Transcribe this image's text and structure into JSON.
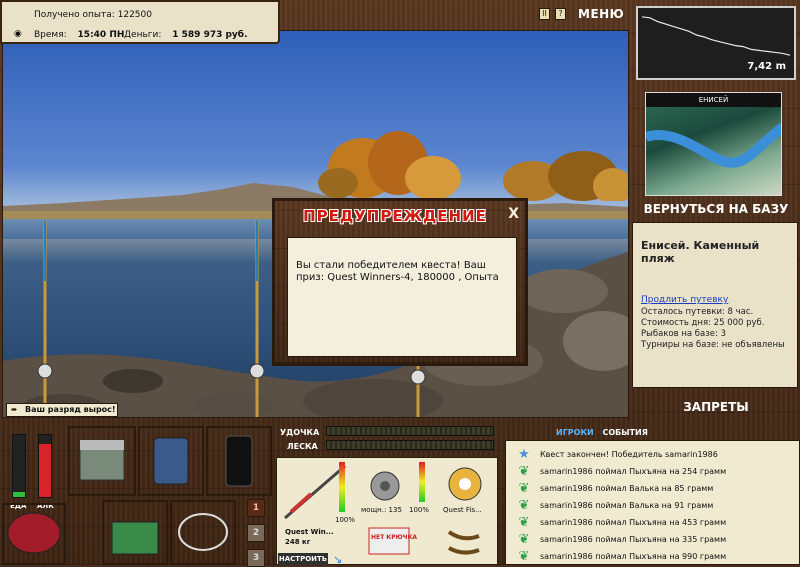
{
  "stats": {
    "exp_label": "Получено опыта:",
    "exp_value": "122500",
    "time_label": "Время:",
    "time_value": "15:40 ПН",
    "money_label": "Деньги:",
    "money_value": "1 589 973 руб."
  },
  "topbar": {
    "pause": "II",
    "help": "?",
    "menu": "МЕНЮ"
  },
  "depth": {
    "value": "7,42 m",
    "profile": [
      0.1,
      0.12,
      0.2,
      0.25,
      0.3,
      0.35,
      0.4,
      0.48,
      0.52,
      0.58,
      0.62,
      0.66,
      0.7,
      0.72,
      0.78,
      0.8,
      0.82,
      0.84,
      0.86,
      0.9
    ]
  },
  "map": {
    "title": "ЕНИСЕЙ"
  },
  "right_panel": {
    "return_label": "ВЕРНУТЬСЯ НА БАЗУ",
    "location_title": "Енисей. Каменный пляж",
    "extend_link": "Продлить путевку",
    "lines": [
      "Осталось путевки: 8 час.",
      "Стоимость дня: 25 000 руб.",
      "Рыбаков на базе: 3",
      "Турниры на базе: не объявлены"
    ],
    "bans_label": "ЗАПРЕТЫ"
  },
  "dialog": {
    "title": "ПРЕДУПРЕЖДЕНИЕ",
    "close": "X",
    "message": "Вы стали победителем квеста! Ваш приз: Quest Winners-4, 180000 , Опыта"
  },
  "rank_notice": "Ваш разряд вырос!",
  "meters": {
    "food_label": "ЕДА",
    "alc_label": "АЛК",
    "food_level": 0.08,
    "alc_level": 0.85
  },
  "gear": {
    "rod_label": "УДОЧКА",
    "line_label": "ЛЕСКА"
  },
  "tackle": {
    "rod_name": "Quest Win...",
    "rod_weight": "248 кг",
    "rod_percent": "100%",
    "reel_power": "мощн.: 135",
    "reel_percent": "100%",
    "line_name": "Quest Fis...",
    "no_hook": "НЕТ КРЮЧКА",
    "setup_button": "НАСТРОИТЬ"
  },
  "slot_tabs": [
    "1",
    "2",
    "3"
  ],
  "chat": {
    "tab_players": "ИГРОКИ",
    "tab_events": "СОБЫТИЯ",
    "messages": [
      "Квест закончен! Победитель samarin1986",
      "samarin1986 поймал Пыхъяна на 254 грамм",
      "samarin1986 поймал Валька на 85 грамм",
      "samarin1986 поймал Валька на 91 грамм",
      "samarin1986 поймал Пыхъяна на 453 грамм",
      "samarin1986 поймал Пыхъяна на 335 грамм",
      "samarin1986 поймал Пыхъяна на 990 грамм"
    ]
  },
  "colors": {
    "wood": "#4a2e1a",
    "panel": "#e9e2c9",
    "warning_red": "#d21a10",
    "butterfly_green": "#2ea04a"
  }
}
